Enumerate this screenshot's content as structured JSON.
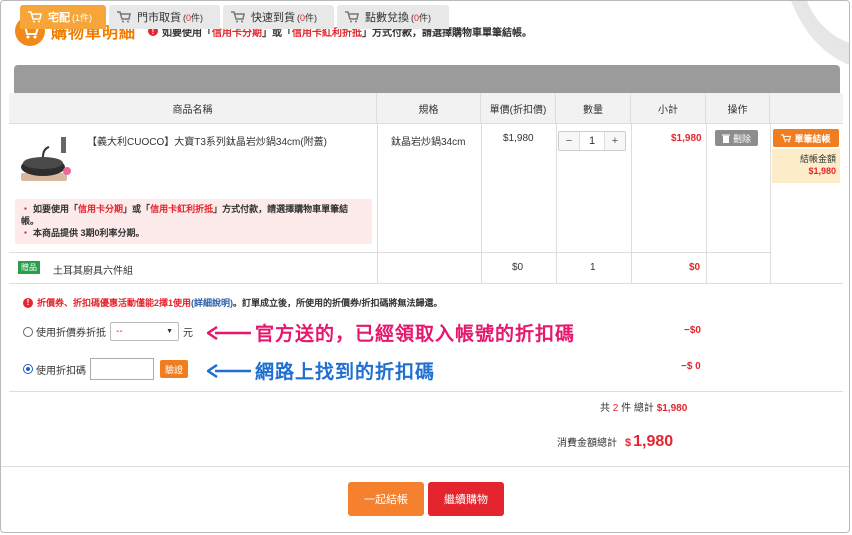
{
  "header": {
    "title": "購物車明細",
    "notice_pre": "如要使用「",
    "notice_hl1": "信用卡分期",
    "notice_mid": "」或「",
    "notice_hl2": "信用卡紅利折抵",
    "notice_post": "」方式付款，請選擇購物車單筆結帳。"
  },
  "tabs": [
    {
      "label": "宅配",
      "count_pre": "(",
      "count": "1",
      "count_post": "件)",
      "active": true
    },
    {
      "label": "門市取貨",
      "count_pre": "(",
      "count": "0",
      "count_post": "件)",
      "active": false
    },
    {
      "label": "快速到貨",
      "count_pre": "(",
      "count": "0",
      "count_post": "件)",
      "active": false
    },
    {
      "label": "點數兌換",
      "count_pre": "(",
      "count": "0",
      "count_post": "件)",
      "active": false
    }
  ],
  "table": {
    "headers": [
      "商品名稱",
      "規格",
      "單價(折扣價)",
      "數量",
      "小計",
      "操作"
    ]
  },
  "item": {
    "name": "【義大利CUOCO】大寶T3系列鈦晶岩炒鍋34cm(附蓋)",
    "spec": "鈦晶岩炒鍋34cm",
    "price": "$1,980",
    "qty": "1",
    "qty_minus": "−",
    "qty_plus": "+",
    "subtotal": "$1,980",
    "delete_label": "刪除",
    "single_checkout": "單筆結帳",
    "checkout_amount_label": "結帳金額",
    "checkout_amount": "$1,980",
    "note1_pre": "如要使用「",
    "note1_hl1": "信用卡分期",
    "note1_mid": "」或「",
    "note1_hl2": "信用卡紅利折抵",
    "note1_post": "」方式付款，請選擇購物車單筆結帳。",
    "note2": "本商品提供 3期0利率分期。"
  },
  "gift": {
    "badge": "贈品",
    "name": "土耳其廚具六件組",
    "price": "$0",
    "qty": "1",
    "subtotal": "$0"
  },
  "coupon": {
    "note_hl": "折價券、折扣碼優惠活動僅能2擇1使用",
    "note_link": "(詳細說明)",
    "note_post": "。訂單成立後，所使用的折價券/折扣碼將無法歸還。",
    "option1_label": "使用折價券折抵",
    "option1_select": "--",
    "option1_unit": "元",
    "option1_amount": "−$0",
    "option2_label": "使用折扣碼",
    "option2_placeholder": "",
    "verify_label": "驗證",
    "option2_amount": "−$ 0"
  },
  "annotations": {
    "pink": "官方送的，已經領取入帳號的折扣碼",
    "blue": "網路上找到的折扣碼"
  },
  "summary": {
    "count_pre": "共",
    "count": "2",
    "count_post": "件 總計",
    "total": "$1,980",
    "grand_label": "消費金額總計",
    "grand_currency": "$",
    "grand_total": "1,980"
  },
  "buttons": {
    "checkout_all": "一起結帳",
    "continue": "繼續購物"
  },
  "colors": {
    "accent": "#f07d00",
    "red": "#e4252d",
    "pink_annotation": "#e5176e",
    "blue_annotation": "#1e6fd0"
  }
}
